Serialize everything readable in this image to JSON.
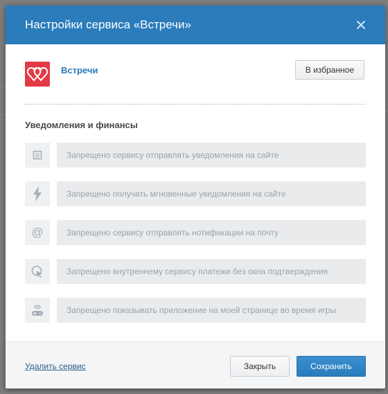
{
  "dialog": {
    "title": "Настройки сервиса «Встречи»",
    "close_icon": "close-icon"
  },
  "app": {
    "name": "Встречи",
    "logo_icon": "two-hearts-icon",
    "favorite_label": "В избранное"
  },
  "section": {
    "title": "Уведомления и финансы"
  },
  "permissions": [
    {
      "icon": "document-icon",
      "text": "Запрещено сервису отправлять уведомления на сайте"
    },
    {
      "icon": "lightning-icon",
      "text": "Запрещено получать мгновенные уведомления на сайте"
    },
    {
      "icon": "at-icon",
      "text": "Запрещено сервису отправлять нотификации на почту"
    },
    {
      "icon": "payment-cursor-icon",
      "text": "Запрещено внутреннему сервису платежи без окна подтверждения"
    },
    {
      "icon": "gamepad-icon",
      "text": "Запрещено показывать приложение на моей странице во время игры"
    }
  ],
  "footer": {
    "remove_label": "Удалить сервис",
    "close_label": "Закрыть",
    "save_label": "Сохранить"
  },
  "colors": {
    "header": "#2a7cbb",
    "accent": "#2a7cbb",
    "logo": "#e23b45"
  }
}
